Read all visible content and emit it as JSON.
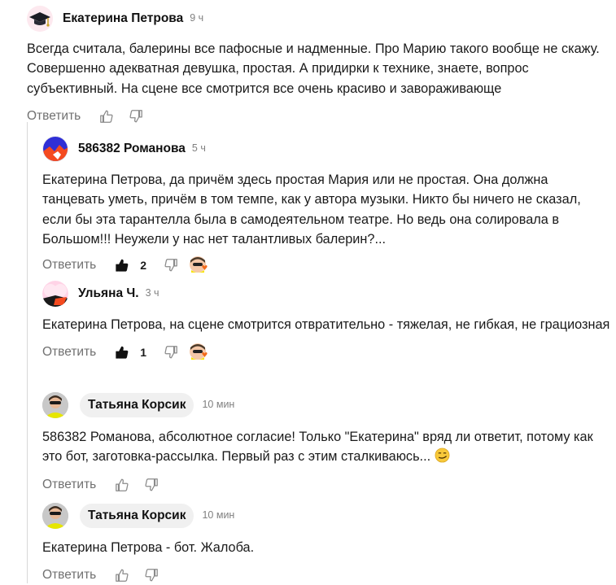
{
  "comments": [
    {
      "author": "Екатерина Петрова",
      "time": "9 ч",
      "text": "Всегда считала, балерины все пафосные и надменные. Про Марию такого вообще не скажу. Совершенно адекватная девушка, простая. А придирки к технике, знаете, вопрос субъективный. На сцене все смотрится все очень красиво и завораживающе",
      "reply_label": "Ответить",
      "avatar_icon": "graduation-cap-icon"
    },
    {
      "author": "586382 Романова",
      "time": "5 ч",
      "text": "Екатерина Петрова, да причём здесь простая Мария или не простая. Она должна танцевать уметь, причём в том темпе, как у автора музыки. Никто бы ничего не сказал, если бы эта тарантелла была в самодеятельном театре. Но ведь она солировала в Большом!!! Неужели у нас нет талантливых балерин?...",
      "reply_label": "Ответить",
      "likes": "2"
    },
    {
      "author": "Ульяна Ч.",
      "time": "3 ч",
      "text": "Екатерина Петрова, на сцене смотрится отвратительно - тяжелая, не гибкая, не грациозная",
      "reply_label": "Ответить",
      "likes": "1"
    },
    {
      "author": "Татьяна Корсик",
      "time": "10 мин",
      "text": "586382 Романова, абсолютное согласие! Только \"Екатерина\" вряд ли ответит, потому как это бот, заготовка-рассылка. Первый раз с этим сталкиваюсь...",
      "reply_label": "Ответить",
      "emoji": "smirk-emoji"
    },
    {
      "author": "Татьяна Корсик",
      "time": "10 мин",
      "text": "Екатерина Петрова - бот. Жалоба.",
      "reply_label": "Ответить"
    }
  ],
  "colors": {
    "muted": "#707070",
    "thread_line": "#d8d8d8",
    "accent_orange": "#f26a1b",
    "accent_yellow": "#f7e300"
  }
}
